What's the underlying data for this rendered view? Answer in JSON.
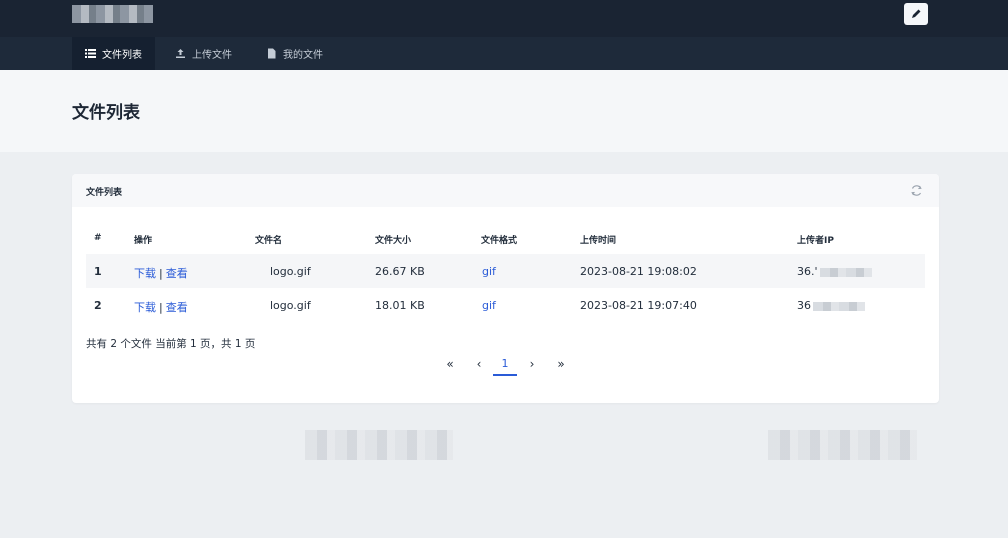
{
  "header": {
    "edit_icon": "pencil-icon"
  },
  "nav": {
    "items": [
      {
        "label": "文件列表",
        "icon": "list-icon"
      },
      {
        "label": "上传文件",
        "icon": "upload-icon"
      },
      {
        "label": "我的文件",
        "icon": "file-icon"
      }
    ]
  },
  "page": {
    "title": "文件列表"
  },
  "card": {
    "title": "文件列表",
    "refresh_icon": "refresh-icon"
  },
  "table": {
    "headers": [
      "#",
      "操作",
      "文件名",
      "文件大小",
      "文件格式",
      "上传时间",
      "上传者IP"
    ],
    "rows": [
      {
        "num": "1",
        "download": "下载",
        "sep": "|",
        "view": "查看",
        "name": "logo.gif",
        "size": "26.67 KB",
        "format": "gif",
        "time": "2023-08-21 19:08:02",
        "ip": "36.'"
      },
      {
        "num": "2",
        "download": "下载",
        "sep": "|",
        "view": "查看",
        "name": "logo.gif",
        "size": "18.01 KB",
        "format": "gif",
        "time": "2023-08-21 19:07:40",
        "ip": "36"
      }
    ]
  },
  "summary": "共有 2 个文件  当前第 1 页，共 1 页",
  "pagination": {
    "first": "«",
    "prev": "‹",
    "current": "1",
    "next": "›",
    "last": "»"
  },
  "colors": {
    "topbar": "#1a2433",
    "navbar": "#1e2a3a",
    "link": "#2a5bd7"
  }
}
